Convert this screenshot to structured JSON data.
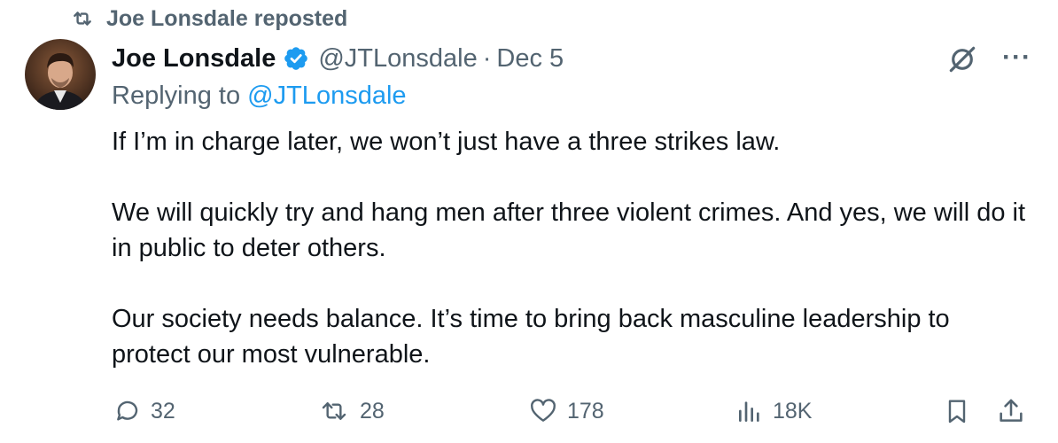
{
  "repost": {
    "label": "Joe Lonsdale reposted",
    "icon": "repost-icon"
  },
  "author": {
    "name": "Joe Lonsdale",
    "handle": "@JTLonsdale",
    "separator": "·",
    "date": "Dec 5",
    "verified_icon": "verified-badge-icon",
    "verified_color": "#1d9bf0"
  },
  "replying": {
    "prefix": "Replying to",
    "handle": "@JTLonsdale"
  },
  "tweet": {
    "paragraphs": [
      "If I’m in charge later, we won’t just have a three strikes law.",
      "We will quickly try and hang men after three violent crimes. And yes, we will do it in public to deter others.",
      "Our society needs balance. It’s time to bring back masculine leadership to protect our most vulnerable."
    ]
  },
  "header_actions": {
    "grok_icon": "grok-icon",
    "more_label": "···"
  },
  "actions": {
    "reply": {
      "icon": "reply-icon",
      "count": "32"
    },
    "repost": {
      "icon": "repost-icon",
      "count": "28"
    },
    "like": {
      "icon": "heart-icon",
      "count": "178"
    },
    "views": {
      "icon": "views-chart-icon",
      "count": "18K"
    },
    "bookmark": {
      "icon": "bookmark-icon"
    },
    "share": {
      "icon": "share-icon"
    }
  },
  "colors": {
    "text": "#0f1419",
    "secondary": "#536471",
    "accent": "#1d9bf0"
  }
}
